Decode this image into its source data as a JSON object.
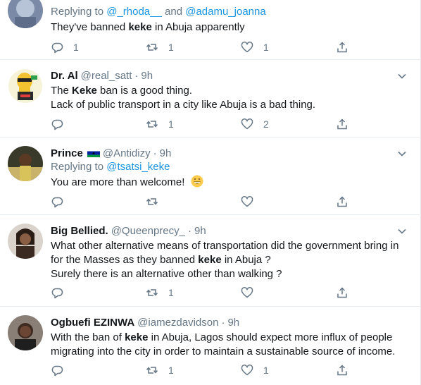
{
  "tweets": [
    {
      "name": "",
      "handle": "",
      "time": "",
      "replying_prefix": "Replying to",
      "replying_to": [
        "@_rhoda__",
        "@adamu_joanna"
      ],
      "replying_sep": "and",
      "lines": [
        [
          {
            "t": "They've banned "
          },
          {
            "t": "keke",
            "b": true
          },
          {
            "t": " in Abuja apparently"
          }
        ]
      ],
      "reply_count": "1",
      "retweet_count": "1",
      "like_count": "1"
    },
    {
      "name": "Dr. Al",
      "handle": "@real_satt",
      "time": "9h",
      "lines": [
        [
          {
            "t": "The "
          },
          {
            "t": "Keke",
            "b": true
          },
          {
            "t": " ban is a good thing."
          }
        ],
        [
          {
            "t": "Lack of public transport in a city like Abuja is a bad thing."
          }
        ]
      ],
      "reply_count": "",
      "retweet_count": "1",
      "like_count": "2"
    },
    {
      "name": "Prince",
      "handle": "@Antidizy",
      "time": "9h",
      "replying_prefix": "Replying to",
      "replying_to": [
        "@tsatsi_keke"
      ],
      "lines": [
        [
          {
            "t": "You are more than welcome! "
          }
        ]
      ],
      "emoji": "grinning-face",
      "reply_count": "",
      "retweet_count": "",
      "like_count": ""
    },
    {
      "name": "Big Bellied.",
      "handle": "@Queenprecy_",
      "time": "9h",
      "lines": [
        [
          {
            "t": "What other alternative means of transportation did the government bring in"
          }
        ],
        [
          {
            "t": "for the Masses as they banned "
          },
          {
            "t": "keke",
            "b": true
          },
          {
            "t": " in Abuja ?"
          }
        ],
        [
          {
            "t": "Surely there is an alternative other than walking ?"
          }
        ]
      ],
      "reply_count": "",
      "retweet_count": "1",
      "like_count": ""
    },
    {
      "name": "Ogbuefi EZINWA",
      "handle": "@iamezdavidson",
      "time": "9h",
      "lines": [
        [
          {
            "t": "With the ban of "
          },
          {
            "t": "keke",
            "b": true
          },
          {
            "t": " in Abuja, Lagos should expect more influx of people"
          }
        ],
        [
          {
            "t": "migrating into the city in order to maintain a sustainable source of income."
          }
        ]
      ],
      "reply_count": "",
      "retweet_count": "1",
      "like_count": "1"
    }
  ],
  "colors": {
    "name": "#14171a",
    "muted": "#657786",
    "link": "#1b95e0",
    "divider": "#e6ecf0"
  },
  "icons": [
    "reply-icon",
    "retweet-icon",
    "like-icon",
    "share-icon",
    "chevron-down-icon",
    "lesotho-flag-icon"
  ]
}
